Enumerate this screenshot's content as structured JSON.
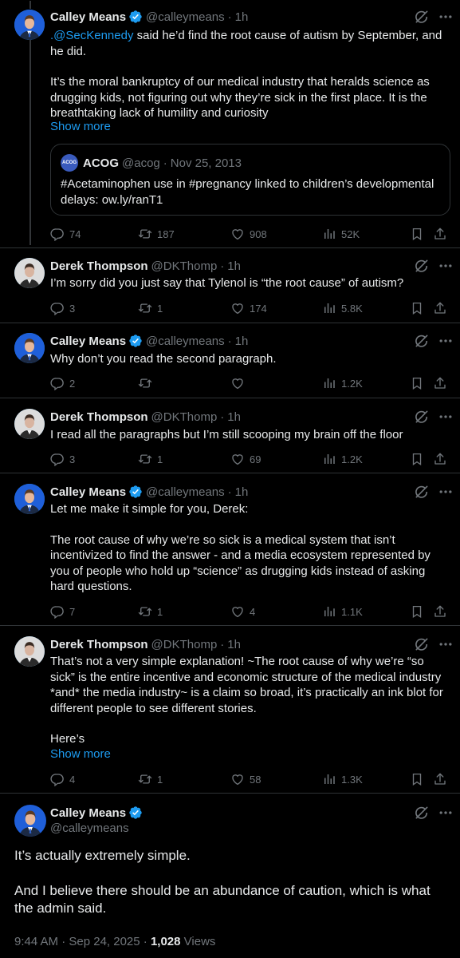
{
  "thread": [
    {
      "name": "Calley Means",
      "handle": "@calleymeans",
      "time": "1h",
      "mention": ".@SecKennedy",
      "text1_rest": " said he’d find the root cause of autism by September, and he did.",
      "text2": "It’s the moral bankruptcy of our medical industry that heralds science as drugging kids, not figuring out why they’re sick in the first place. It is the breathtaking lack of humility and curiosity",
      "show_more": "Show more",
      "quote": {
        "avatar_text": "ACOG",
        "name": "ACOG",
        "handle": "@acog",
        "date": "Nov 25, 2013",
        "text": "#Acetaminophen use in #pregnancy linked to children’s developmental delays: ow.ly/ranT1"
      },
      "replies": "74",
      "reposts": "187",
      "likes": "908",
      "views": "52K"
    },
    {
      "name": "Derek Thompson",
      "handle": "@DKThomp",
      "time": "1h",
      "text": "I’m sorry did you just say that Tylenol is “the root cause” of autism?",
      "replies": "3",
      "reposts": "1",
      "likes": "174",
      "views": "5.8K"
    },
    {
      "name": "Calley Means",
      "handle": "@calleymeans",
      "time": "1h",
      "text": "Why don’t you read the second paragraph.",
      "replies": "2",
      "reposts": "",
      "likes": "",
      "views": "1.2K"
    },
    {
      "name": "Derek Thompson",
      "handle": "@DKThomp",
      "time": "1h",
      "text": "I read all the paragraphs but I’m still scooping my brain off the floor",
      "replies": "3",
      "reposts": "1",
      "likes": "69",
      "views": "1.2K"
    },
    {
      "name": "Calley Means",
      "handle": "@calleymeans",
      "time": "1h",
      "text1": "Let me make it simple for you, Derek:",
      "text2": "The root cause of why we’re so sick is a medical system that isn’t incentivized to find the answer - and a media ecosystem represented by you of people who hold up “science” as drugging kids instead of asking hard questions.",
      "replies": "7",
      "reposts": "1",
      "likes": "4",
      "views": "1.1K"
    },
    {
      "name": "Derek Thompson",
      "handle": "@DKThomp",
      "time": "1h",
      "text1": "That’s not a very simple explanation! ~The root cause of why we’re “so sick” is the entire incentive and economic structure of the medical industry *and* the media industry~ is a claim so broad, it’s practically an ink blot for different people to see different stories.",
      "text2": "Here’s",
      "show_more": "Show more",
      "replies": "4",
      "reposts": "1",
      "likes": "58",
      "views": "1.3K"
    }
  ],
  "main": {
    "name": "Calley Means",
    "handle": "@calleymeans",
    "text1": "It’s actually extremely simple.",
    "text2": "And I believe there should be an abundance of caution, which is what the admin said.",
    "time": "9:44 AM · Sep 24, 2025 · ",
    "views_count": "1,028",
    "views_label": " Views"
  },
  "colors": {
    "background": "#000000",
    "text": "#e7e9ea",
    "muted": "#71767b",
    "link": "#1d9bf0",
    "border": "#2f3336"
  },
  "icons": [
    "verified-badge-icon",
    "grok-icon",
    "more-icon",
    "reply-icon",
    "repost-icon",
    "like-icon",
    "views-icon",
    "bookmark-icon",
    "share-icon"
  ]
}
